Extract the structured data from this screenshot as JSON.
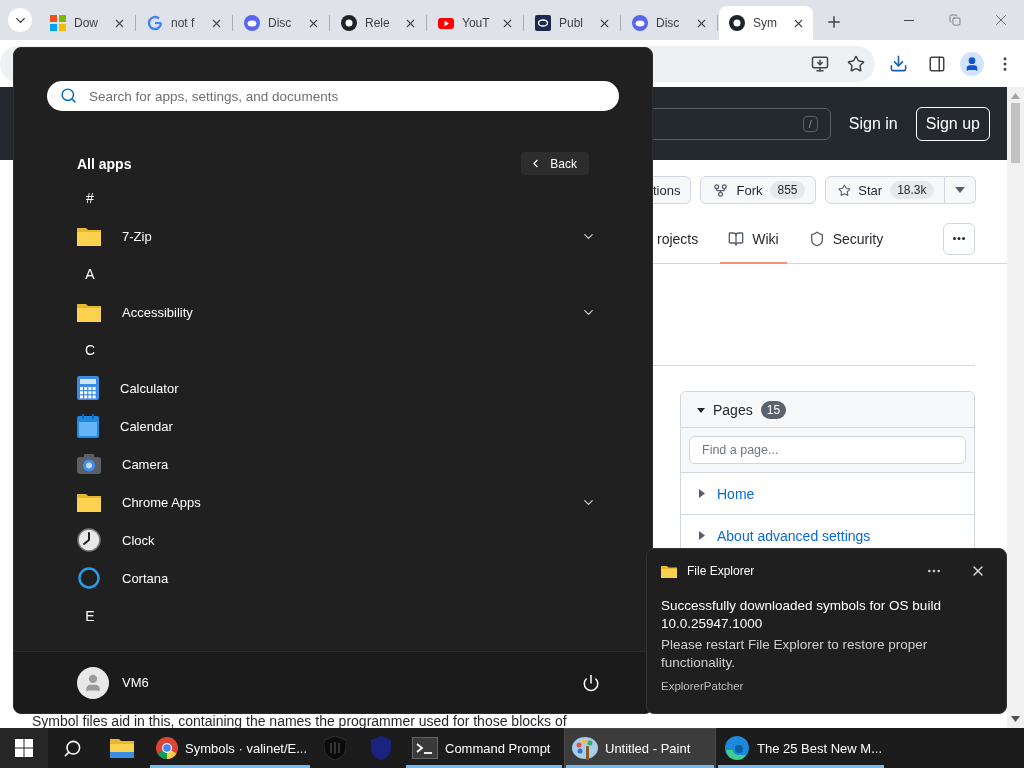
{
  "browser": {
    "tabs": [
      {
        "title": "Dow",
        "selected": false
      },
      {
        "title": "not f",
        "selected": false
      },
      {
        "title": "Disc",
        "selected": false
      },
      {
        "title": "Rele",
        "selected": false
      },
      {
        "title": "YouT",
        "selected": false
      },
      {
        "title": "Publ",
        "selected": false
      },
      {
        "title": "Disc",
        "selected": false
      },
      {
        "title": "Sym",
        "selected": true
      }
    ]
  },
  "github": {
    "search_key": "/",
    "sign_in": "Sign in",
    "sign_up": "Sign up",
    "repo_buttons": [
      {
        "kind": "plain",
        "label": "tions"
      },
      {
        "kind": "fork",
        "label": "Fork",
        "count": "855"
      },
      {
        "kind": "star",
        "label": "Star",
        "count": "18.3k"
      }
    ],
    "nav": [
      {
        "kind": "plain",
        "label": "rojects",
        "selected": false
      },
      {
        "kind": "book",
        "label": "Wiki",
        "selected": true
      },
      {
        "kind": "shield",
        "label": "Security",
        "selected": false
      }
    ],
    "pages": {
      "title": "Pages",
      "count": "15",
      "expanded": true,
      "search_placeholder": "Find a page...",
      "items": [
        "Home",
        "About advanced settings"
      ]
    },
    "body_text": "Symbol files aid in this, containing the names the programmer used for those blocks of"
  },
  "start_menu": {
    "search_placeholder": "Search for apps, settings, and documents",
    "heading": "All apps",
    "back": "Back",
    "entries": [
      {
        "kind": "letter",
        "label": "#"
      },
      {
        "kind": "folder",
        "label": "7-Zip",
        "expanded": false
      },
      {
        "kind": "letter",
        "label": "A"
      },
      {
        "kind": "folder",
        "label": "Accessibility",
        "expanded": false
      },
      {
        "kind": "letter",
        "label": "C"
      },
      {
        "kind": "app",
        "label": "Calculator"
      },
      {
        "kind": "app",
        "label": "Calendar"
      },
      {
        "kind": "app",
        "label": "Camera"
      },
      {
        "kind": "folder",
        "label": "Chrome Apps",
        "expanded": false
      },
      {
        "kind": "app",
        "label": "Clock"
      },
      {
        "kind": "app",
        "label": "Cortana"
      },
      {
        "kind": "letter",
        "label": "E"
      }
    ],
    "user": "VM6"
  },
  "notification": {
    "app": "File Explorer",
    "title": "Successfully downloaded symbols for OS build 10.0.25947.1000",
    "message": "Please restart File Explorer to restore proper functionality.",
    "source": "ExplorerPatcher"
  },
  "taskbar": {
    "items": [
      {
        "kind": "start",
        "running": false,
        "selected": false
      },
      {
        "kind": "search",
        "running": false,
        "selected": false
      },
      {
        "kind": "explorer",
        "running": false,
        "selected": false
      },
      {
        "kind": "chrome",
        "label": "Symbols · valinet/E...",
        "running": true,
        "selected": false
      },
      {
        "kind": "dark-shield",
        "running": false,
        "selected": false
      },
      {
        "kind": "blue-shield",
        "running": false,
        "selected": false
      },
      {
        "kind": "terminal",
        "label": "Command Prompt",
        "running": true,
        "selected": false
      },
      {
        "kind": "paint",
        "label": "Untitled - Paint",
        "running": true,
        "selected": true
      },
      {
        "kind": "edge",
        "label": "The 25 Best New M...",
        "running": true,
        "selected": false
      }
    ]
  }
}
